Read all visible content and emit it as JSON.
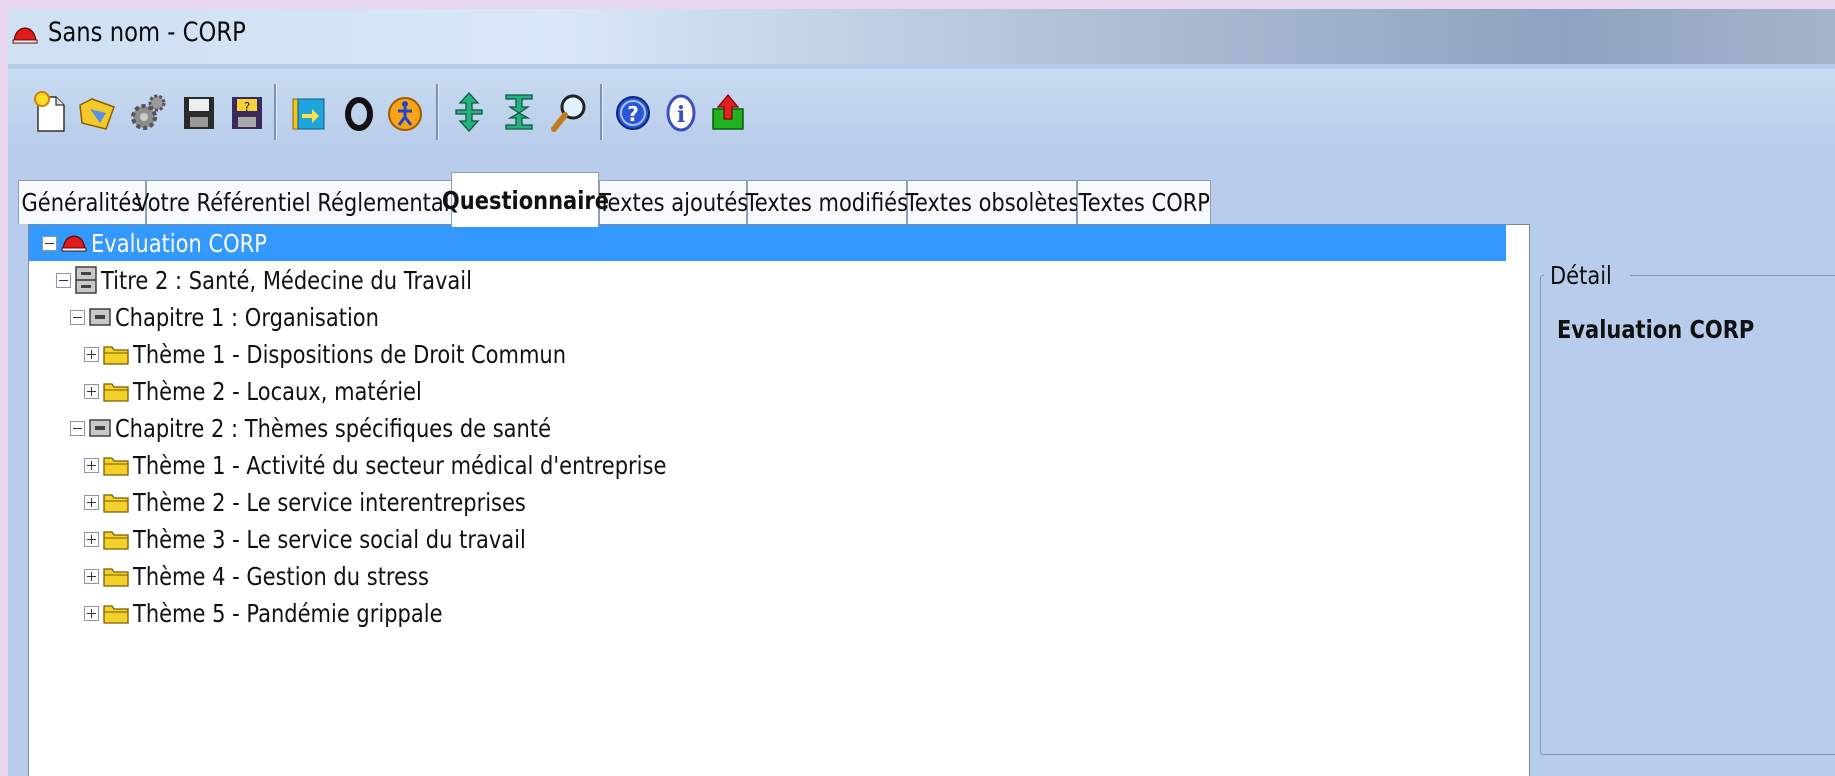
{
  "window": {
    "title": "Sans nom - CORP"
  },
  "toolbar": {
    "buttons": [
      {
        "icon": "new-document-icon"
      },
      {
        "icon": "open-folder-icon"
      },
      {
        "icon": "settings-gear-icon"
      },
      {
        "icon": "save-floppy-icon"
      },
      {
        "icon": "save-as-floppy-icon"
      },
      {
        "icon": "export-book-icon"
      },
      {
        "icon": "ring-icon"
      },
      {
        "icon": "figure-circle-icon"
      },
      {
        "icon": "expand-arrows-icon"
      },
      {
        "icon": "collapse-arrows-icon"
      },
      {
        "icon": "search-magnifier-icon"
      },
      {
        "icon": "help-icon"
      },
      {
        "icon": "info-icon"
      },
      {
        "icon": "exit-icon"
      }
    ]
  },
  "tabs": [
    {
      "label": "Généralités"
    },
    {
      "label": "Votre Référentiel Réglementaire"
    },
    {
      "label": "Questionnaire"
    },
    {
      "label": "Textes ajoutés"
    },
    {
      "label": "Textes modifiés"
    },
    {
      "label": "Textes obsolètes"
    },
    {
      "label": "Textes CORP"
    }
  ],
  "tree": {
    "nodes": [
      {
        "label": "Evaluation CORP",
        "level": 0,
        "icon": "helmet-icon",
        "expanded": true,
        "selected": true
      },
      {
        "label": "Titre 2 : Santé, Médecine du Travail",
        "level": 1,
        "icon": "cabinet-icon",
        "expanded": true
      },
      {
        "label": "Chapitre 1 : Organisation",
        "level": 2,
        "icon": "drawer-icon",
        "expanded": true
      },
      {
        "label": "Thème 1 - Dispositions de Droit Commun",
        "level": 3,
        "icon": "folder-icon",
        "expanded": false
      },
      {
        "label": "Thème 2 - Locaux, matériel",
        "level": 3,
        "icon": "folder-icon",
        "expanded": false
      },
      {
        "label": "Chapitre 2 : Thèmes spécifiques de santé",
        "level": 2,
        "icon": "drawer-icon",
        "expanded": true
      },
      {
        "label": "Thème 1 - Activité du secteur médical d'entreprise",
        "level": 3,
        "icon": "folder-icon",
        "expanded": false
      },
      {
        "label": "Thème 2 - Le service interentreprises",
        "level": 3,
        "icon": "folder-icon",
        "expanded": false
      },
      {
        "label": "Thème 3 - Le service social du travail",
        "level": 3,
        "icon": "folder-icon",
        "expanded": false
      },
      {
        "label": "Thème 4 - Gestion du stress",
        "level": 3,
        "icon": "folder-icon",
        "expanded": false
      },
      {
        "label": "Thème 5 - Pandémie grippale",
        "level": 3,
        "icon": "folder-icon",
        "expanded": false
      }
    ]
  },
  "detail": {
    "group_label": "Détail",
    "title": "Evaluation CORP"
  },
  "colors": {
    "selection": "#3399ff",
    "window_bg": "#b7cdeb"
  }
}
